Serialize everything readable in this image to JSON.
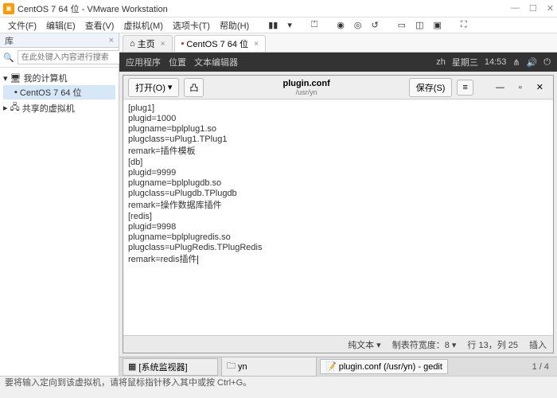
{
  "window": {
    "title": "CentOS 7 64 位 - VMware Workstation"
  },
  "menu": {
    "items": [
      "文件(F)",
      "编辑(E)",
      "查看(V)",
      "虚拟机(M)",
      "选项卡(T)",
      "帮助(H)"
    ]
  },
  "sidebar": {
    "header": "库",
    "search_placeholder": "在此处键入内容进行搜索",
    "root": "我的计算机",
    "vm": "CentOS 7 64 位",
    "shared": "共享的虚拟机"
  },
  "tabs": {
    "home": "主页",
    "vm": "CentOS 7 64 位"
  },
  "gnome": {
    "apps": "应用程序",
    "places": "位置",
    "editor": "文本编辑器",
    "lang": "zh",
    "day": "星期三",
    "time": "14:53"
  },
  "gedit": {
    "open": "打开(O)",
    "save": "保存(S)",
    "filename": "plugin.conf",
    "path": "/usr/yn",
    "content": "[plug1]\nplugid=1000\nplugname=bplplug1.so\nplugclass=uPlug1.TPlug1\nremark=插件模板\n[db]\nplugid=9999\nplugname=bplplugdb.so\nplugclass=uPlugdb.TPlugdb\nremark=操作数据库插件\n[redis]\nplugid=9998\nplugname=bplplugredis.so\nplugclass=uPlugRedis.TPlugRedis\nremark=redis插件",
    "status_plain": "纯文本 ▾",
    "status_tab": "制表符宽度：8 ▾",
    "status_pos": "行 13，列 25",
    "status_ins": "插入"
  },
  "taskbar": {
    "monitor": "[系统监视器]",
    "yn": "yn",
    "gedit": "plugin.conf (/usr/yn) - gedit",
    "pager": "1 / 4"
  },
  "footer": "要将输入定向到该虚拟机，请将鼠标指针移入其中或按 Ctrl+G。"
}
